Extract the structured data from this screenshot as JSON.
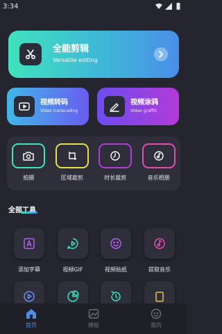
{
  "status_bar": {
    "time": "3:34"
  },
  "hero": {
    "title": "全能剪辑",
    "subtitle": "Versatile editing"
  },
  "cards": [
    {
      "title": "视频转码",
      "subtitle": "Video transcoding"
    },
    {
      "title": "视频涂鸦",
      "subtitle": "Video graffiti"
    }
  ],
  "tools": [
    {
      "label": "拍摄",
      "color": "#3fe2be",
      "icon": "camera-icon"
    },
    {
      "label": "区域裁剪",
      "color": "#e8e04a",
      "icon": "crop-icon"
    },
    {
      "label": "时长裁剪",
      "color": "#b23ad8",
      "icon": "clock-icon"
    },
    {
      "label": "音乐相册",
      "color": "#e84ab0",
      "icon": "music-disc-icon"
    }
  ],
  "section": {
    "title": "全部工具"
  },
  "grid": [
    {
      "label": "添加字幕",
      "icon": "subtitle-icon",
      "color": "#b25ef0"
    },
    {
      "label": "视频GIF",
      "icon": "gif-play-icon",
      "color": "#3fe2be"
    },
    {
      "label": "视频贴纸",
      "icon": "sticker-icon",
      "color": "#b25ef0"
    },
    {
      "label": "提取音乐",
      "icon": "extract-music-icon",
      "color": "#e84ab0"
    },
    {
      "label": "",
      "icon": "video-speed-icon",
      "color": "#6a8cf0"
    },
    {
      "label": "",
      "icon": "pie-chart-icon",
      "color": "#3fe2be"
    },
    {
      "label": "",
      "icon": "rotate-icon",
      "color": "#3fe2be"
    },
    {
      "label": "",
      "icon": "frame-icon",
      "color": "#e8c24a"
    }
  ],
  "bottom_nav": [
    {
      "label": "首页",
      "icon": "home-icon",
      "active": true
    },
    {
      "label": "模板",
      "icon": "template-icon",
      "active": false
    },
    {
      "label": "我的",
      "icon": "profile-icon",
      "active": false
    }
  ]
}
